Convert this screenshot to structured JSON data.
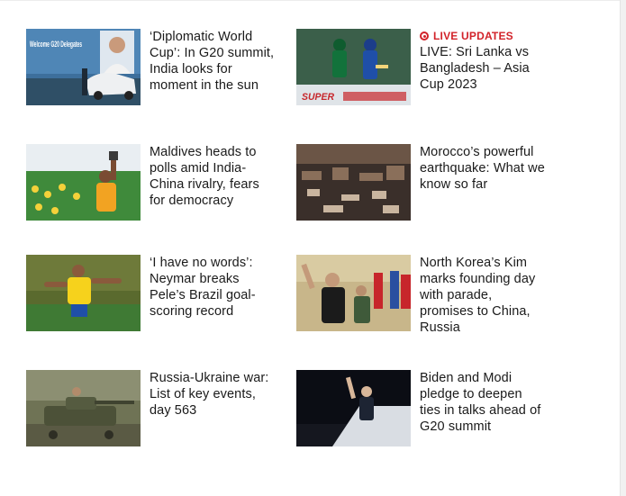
{
  "articles": [
    {
      "headline": "‘Diplomatic World Cup’: In G20 summit, India looks for moment in the sun",
      "image": "g20-welcome-sign-photo",
      "image_text": "Welcome G20 Delegates"
    },
    {
      "headline": "LIVE: Sri Lanka vs Bangladesh – Asia Cup 2023",
      "live_label": "LIVE UPDATES",
      "image": "cricket-match-photo",
      "image_text": "SUPER"
    },
    {
      "headline": "Maldives heads to polls amid India-China rivalry, fears for democracy",
      "image": "maldives-rally-photo"
    },
    {
      "headline": "Morocco’s powerful earthquake: What we know so far",
      "image": "earthquake-rubble-photo"
    },
    {
      "headline": "‘I have no words’: Neymar breaks Pele’s Brazil goal-scoring record",
      "image": "neymar-celebration-photo"
    },
    {
      "headline": "North Korea’s Kim marks founding day with parade, promises to China, Russia",
      "image": "kim-parade-photo"
    },
    {
      "headline": "Russia-Ukraine war: List of key events, day 563",
      "image": "tank-soldiers-photo"
    },
    {
      "headline": "Biden and Modi pledge to deepen ties in talks ahead of G20 summit",
      "image": "biden-plane-photo"
    }
  ],
  "colors": {
    "live_accent": "#d2232a",
    "headline": "#1a1a1a"
  }
}
